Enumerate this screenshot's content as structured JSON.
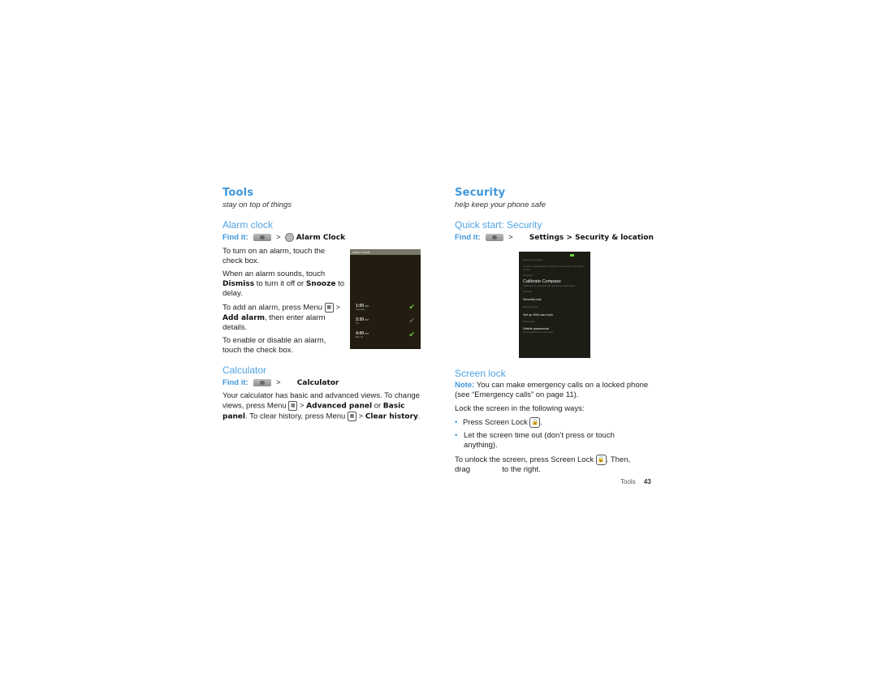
{
  "left": {
    "title": "Tools",
    "subtitle": "stay on top of things",
    "alarm": {
      "heading": "Alarm clock",
      "findit_label": "Find it:",
      "findit_sep": ">",
      "findit_target": "Alarm Clock",
      "p1": "To turn on an alarm, touch the check box.",
      "p2_a": "When an alarm sounds, touch",
      "p2_b": "Dismiss",
      "p2_c": "to turn it off or",
      "p2_d": "Snooze",
      "p2_e": "to delay.",
      "p3_a": "To add an alarm, press Menu",
      "p3_b": ">",
      "p3_c": "Add alarm",
      "p3_d": ", then enter alarm details.",
      "p4": "To enable or disable an alarm, touch the check box.",
      "screen": {
        "title": "Alarm Clock",
        "alarms": [
          {
            "time": "1:00",
            "ampm": "PM",
            "days": "every day",
            "enabled": true
          },
          {
            "time": "3:30",
            "ampm": "PM",
            "days": "Tue",
            "enabled": false
          },
          {
            "time": "4:00",
            "ampm": "PM",
            "days": "Mon, Fri",
            "enabled": true
          }
        ]
      }
    },
    "calc": {
      "heading": "Calculator",
      "findit_label": "Find it:",
      "findit_sep": ">",
      "findit_target": "Calculator",
      "p_a": "Your calculator has basic and advanced views. To change views, press Menu",
      "p_b": ">",
      "p_c": "Advanced panel",
      "p_d": "or",
      "p_e": "Basic panel",
      "p_f": ". To clear history, press Menu",
      "p_g": ">",
      "p_h": "Clear history",
      "p_i": "."
    }
  },
  "right": {
    "title": "Security",
    "subtitle": "help keep your phone safe",
    "quick": {
      "heading": "Quick start: Security",
      "findit_label": "Find it:",
      "findit_sep": ">",
      "findit_target": "Settings > Security & location",
      "screen": {
        "header": "Security & location",
        "rows": [
          {
            "text": "Locate to stored/used it requires more battery plus when of step",
            "kind": "dim"
          },
          {
            "text": "Compass",
            "kind": "dim"
          },
          {
            "text": "Calibrate Compass",
            "kind": "big"
          },
          {
            "text": "Calibrate the compass for optimum performance",
            "kind": "dim"
          },
          {
            "text": "Security",
            "kind": "dim"
          },
          {
            "text": "Security lock",
            "kind": "item"
          },
          {
            "text": "SIM card lock",
            "kind": "dim"
          },
          {
            "text": "Set up SIM card lock",
            "kind": "item"
          },
          {
            "text": "Passwords",
            "kind": "dim"
          },
          {
            "text": "Visible passwords",
            "kind": "item"
          },
          {
            "text": "Show password as you type",
            "kind": "dim"
          }
        ]
      }
    },
    "screenlock": {
      "heading": "Screen lock",
      "note_label": "Note:",
      "note_text": "You can make emergency calls on a locked phone (see “Emergency calls” on page 11).",
      "lock_intro": "Lock the screen in the following ways:",
      "bullet1_a": "Press Screen Lock",
      "bullet1_b": ".",
      "bullet2": "Let the screen time out (don’t press or touch anything).",
      "unlock_a": "To unlock the screen, press Screen Lock",
      "unlock_b": ". Then,",
      "unlock_c": "drag",
      "unlock_d": "to the right."
    }
  },
  "footer": {
    "section": "Tools",
    "page": "43"
  }
}
